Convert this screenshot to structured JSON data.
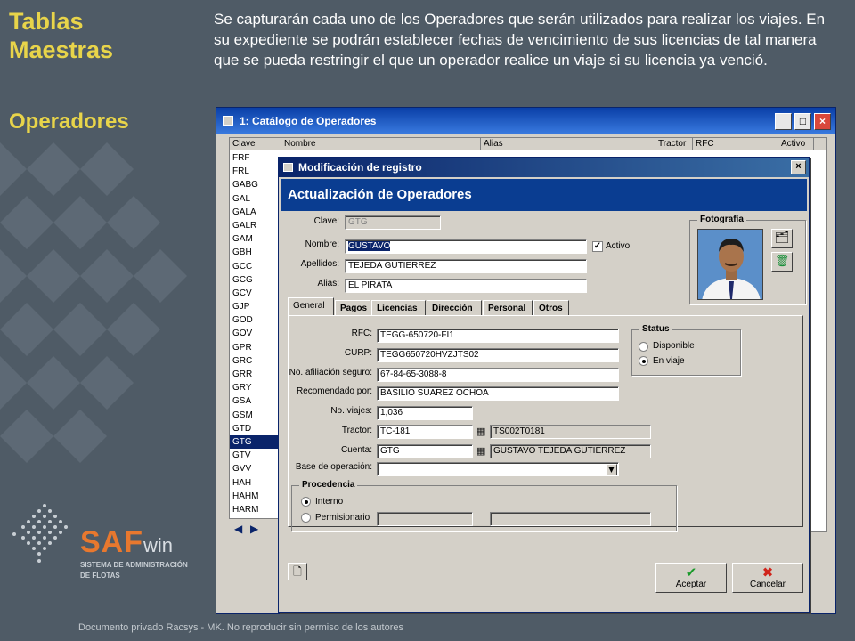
{
  "slide": {
    "title": "Tablas Maestras",
    "subtitle": "Operadores",
    "description": "Se capturarán cada uno de los Operadores que serán utilizados para realizar los viajes. En su expediente se podrán establecer fechas de vencimiento de sus licencias de tal manera que se pueda restringir el que un operador realice un viaje si su licencia ya venció.",
    "footer": "Documento privado Racsys - MK. No reproducir sin permiso de los autores"
  },
  "logo": {
    "brand": "SAF",
    "brand_suffix": "win",
    "line1": "SISTEMA DE ADMINISTRACIÓN",
    "line2": "DE FLOTAS"
  },
  "catalog_window": {
    "title": "1: Catálogo de Operadores",
    "columns": [
      "Clave",
      "Nombre",
      "Alias",
      "Tractor",
      "RFC",
      "Activo"
    ],
    "claves": [
      "FRF",
      "FRL",
      "GABG",
      "GAL",
      "GALA",
      "GALR",
      "GAM",
      "GBH",
      "GCC",
      "GCG",
      "GCV",
      "GJP",
      "GOD",
      "GOV",
      "GPR",
      "GRC",
      "GRR",
      "GRY",
      "GSA",
      "GSM",
      "GTD",
      "GTG",
      "GTV",
      "GVV",
      "HAH",
      "HAHM",
      "HARM"
    ],
    "selected_clave": "GTG"
  },
  "modal": {
    "title": "Modificación de registro",
    "header": "Actualización de Operadores",
    "clave_label": "Clave:",
    "clave_value": "GTG",
    "nombre_label": "Nombre:",
    "nombre_value": "GUSTAVO",
    "activo_label": "Activo",
    "apellidos_label": "Apellidos:",
    "apellidos_value": "TEJEDA GUTIERREZ",
    "alias_label": "Alias:",
    "alias_value": "EL PIRATA",
    "foto_label": "Fotografía",
    "tabs": [
      "General",
      "Pagos",
      "Licencias",
      "Dirección",
      "Personal",
      "Otros"
    ],
    "rfc_label": "RFC:",
    "rfc_value": "TEGG-650720-FI1",
    "curp_label": "CURP:",
    "curp_value": "TEGG650720HVZJTS02",
    "afiliacion_label": "No. afiliación seguro:",
    "afiliacion_value": "67-84-65-3088-8",
    "recomendado_label": "Recomendado por:",
    "recomendado_value": "BASILIO SUAREZ OCHOA",
    "viajes_label": "No. viajes:",
    "viajes_value": "1,036",
    "tractor_label": "Tractor:",
    "tractor_value": "TC-181",
    "tractor_desc": "TS002T0181",
    "cuenta_label": "Cuenta:",
    "cuenta_value": "GTG",
    "cuenta_desc": "GUSTAVO TEJEDA GUTIERREZ",
    "base_label": "Base de operación:",
    "base_value": "",
    "status_title": "Status",
    "status_options": [
      "Disponible",
      "En viaje"
    ],
    "procedencia_title": "Procedencia",
    "procedencia_options": [
      "Interno",
      "Permisionario"
    ],
    "accept_label": "Aceptar",
    "cancel_label": "Cancelar"
  }
}
